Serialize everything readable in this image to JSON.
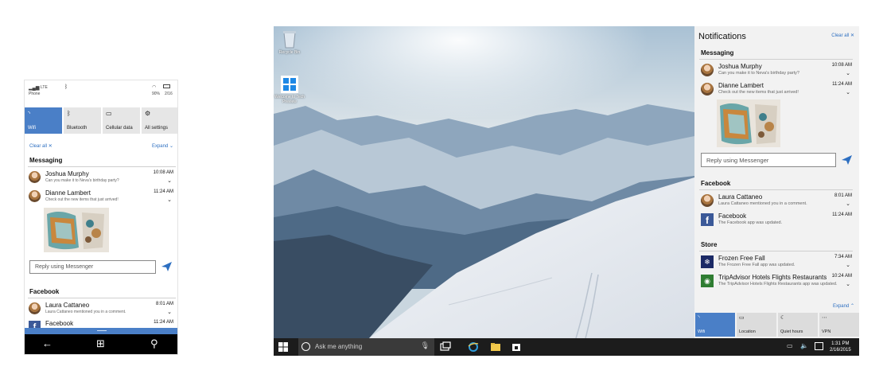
{
  "colors": {
    "accent": "#4a7fc7",
    "link": "#2d6fc1",
    "taskbar": "#1c1c1c",
    "facebook": "#3b5998"
  },
  "phone": {
    "status": {
      "network": "LTE",
      "carrier": "Phone",
      "battery": "90%",
      "date": "2/16"
    },
    "quick_actions": [
      {
        "label": "Wifi",
        "icon": "wifi-icon",
        "active": true
      },
      {
        "label": "Bluetooth",
        "icon": "bluetooth-icon",
        "active": false
      },
      {
        "label": "Cellular data",
        "icon": "cellular-icon",
        "active": false
      },
      {
        "label": "All settings",
        "icon": "gear-icon",
        "active": false
      }
    ],
    "clear_all": "Clear all",
    "expand": "Expand",
    "groups": [
      {
        "name": "Messaging"
      },
      {
        "name": "Facebook"
      }
    ],
    "notifications": [
      {
        "title": "Joshua Murphy",
        "body": "Can you make it to Neva's birthday party?",
        "time": "10:08 AM"
      },
      {
        "title": "Dianne Lambert",
        "body": "Check out the new items that just arrived!",
        "time": "11:24 AM"
      },
      {
        "title": "Laura Cattaneo",
        "body": "Laura Cattaneo mentioned you in a comment.",
        "time": "8:01 AM"
      },
      {
        "title": "Facebook",
        "body": "",
        "time": "11:24 AM"
      }
    ],
    "reply_placeholder": "Reply using Messenger"
  },
  "desktop": {
    "icons": [
      {
        "label": "Recycle Bin",
        "icon": "recycle-bin-icon"
      },
      {
        "label": "Welcome to Tech Preview",
        "icon": "windows-logo-icon"
      }
    ],
    "taskbar": {
      "search_placeholder": "Ask me anything",
      "time": "1:31 PM",
      "date": "2/16/2015"
    },
    "action_center": {
      "title": "Notifications",
      "clear_all": "Clear all",
      "expand": "Expand",
      "groups": [
        {
          "name": "Messaging"
        },
        {
          "name": "Facebook"
        },
        {
          "name": "Store"
        }
      ],
      "notifications": [
        {
          "title": "Joshua Murphy",
          "body": "Can you make it to Neva's birthday party?",
          "time": "10:08 AM"
        },
        {
          "title": "Dianne Lambert",
          "body": "Check out the new items that just arrived!",
          "time": "11:24 AM"
        },
        {
          "title": "Laura Cattaneo",
          "body": "Laura Cattaneo mentioned you in a comment.",
          "time": "8:01 AM"
        },
        {
          "title": "Facebook",
          "body": "The Facebook app was updated.",
          "time": "11:24 AM"
        },
        {
          "title": "Frozen Free Fall",
          "body": "The Frozen Free Fall app was updated.",
          "time": "7:34 AM"
        },
        {
          "title": "TripAdvisor Hotels Flights Restaurants",
          "body": "The TripAdvisor Hotels Flights Restaurants app was updated.",
          "time": "10:24 AM"
        }
      ],
      "reply_placeholder": "Reply using Messenger",
      "quick_actions": [
        {
          "label": "Wifi",
          "icon": "wifi-icon",
          "active": true
        },
        {
          "label": "Location",
          "icon": "location-icon",
          "active": false
        },
        {
          "label": "Quiet hours",
          "icon": "moon-icon",
          "active": false
        },
        {
          "label": "VPN",
          "icon": "vpn-icon",
          "active": false
        }
      ]
    }
  }
}
